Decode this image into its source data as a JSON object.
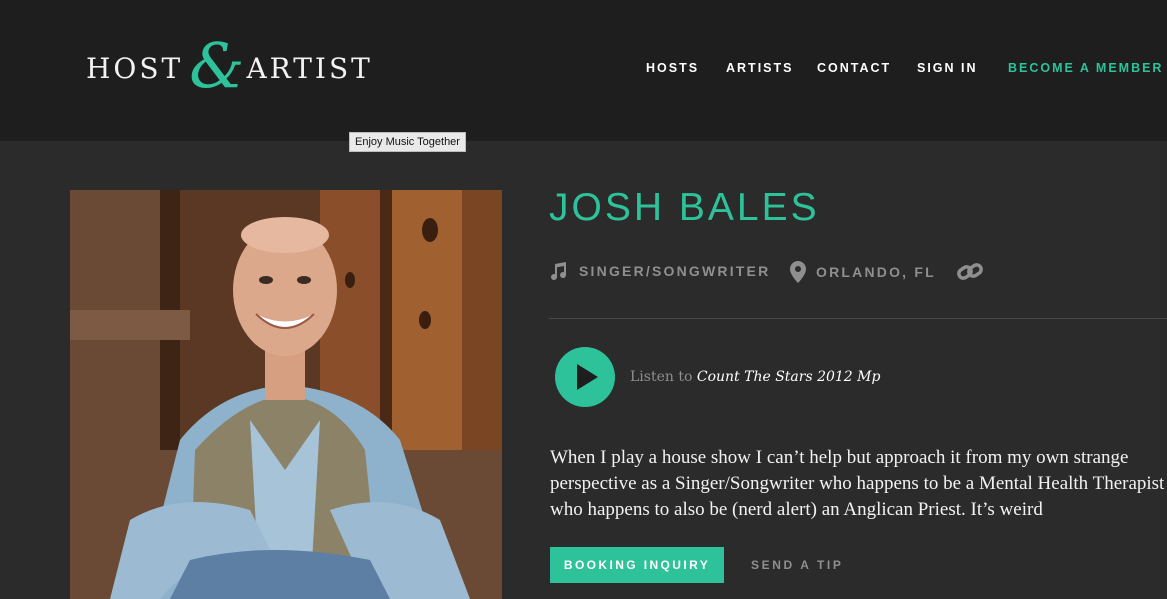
{
  "header": {
    "logo": {
      "word_left": "HOST",
      "ampersand": "&",
      "word_right": "ARTIST"
    },
    "tooltip": "Enjoy Music Together",
    "nav": {
      "hosts": "HOSTS",
      "artists": "ARTISTS",
      "contact": "CONTACT",
      "sign_in": "SIGN IN",
      "become_member": "BECOME A MEMBER"
    }
  },
  "artist": {
    "name": "JOSH BALES",
    "genre": "SINGER/SONGWRITER",
    "location": "ORLANDO, FL",
    "listen_prefix": "Listen to",
    "track": "Count The Stars 2012 Mp",
    "bio": "When I play a house show I can’t help but approach it from my own strange perspective as a Singer/Songwriter who happens to be a Mental Health Therapist who happens to also be (nerd alert) an Anglican Priest. It’s weird"
  },
  "actions": {
    "booking": "BOOKING INQUIRY",
    "tip": "SEND A TIP"
  },
  "colors": {
    "accent": "#2ec29a",
    "header_bg": "#1e1e1e",
    "page_bg": "#2b2b2b",
    "muted": "#8f8f8f"
  },
  "icons": [
    "music-note-icon",
    "location-pin-icon",
    "link-icon",
    "play-icon"
  ]
}
